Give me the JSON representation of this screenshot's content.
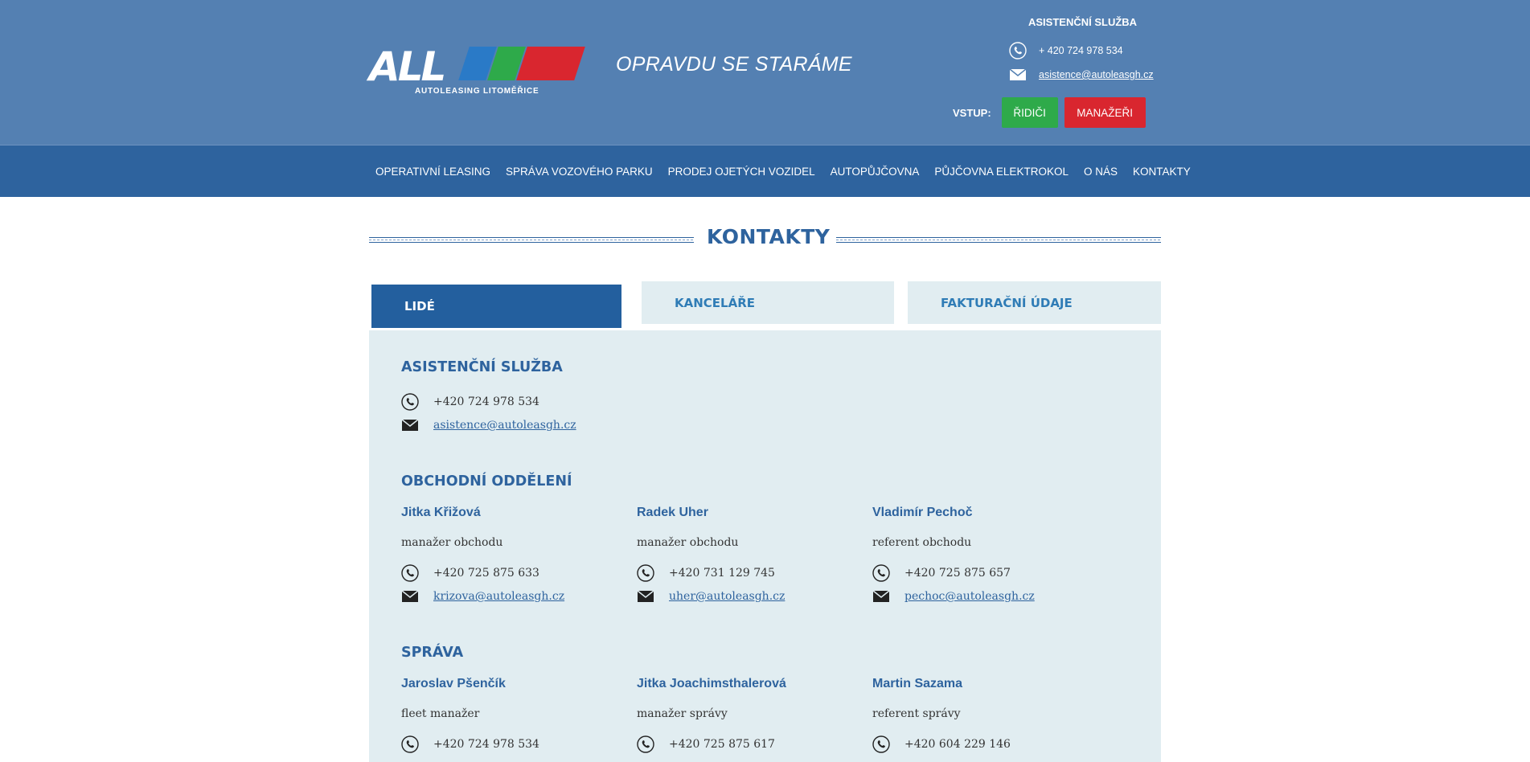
{
  "header": {
    "logo_text": "ALL",
    "logo_subtitle": "AUTOLEASING LITOMĚŘICE",
    "slogan": "OPRAVDU SE STARÁME",
    "assistance": {
      "title": "ASISTENČNÍ SLUŽBA",
      "phone": "+ 420 724 978 534",
      "email": "asistence@autoleasgh.cz",
      "phone_icon": "phone-icon",
      "email_icon": "envelope-icon"
    },
    "login": {
      "label": "VSTUP:",
      "drivers_label": "ŘIDIČI",
      "managers_label": "MANAŽEŘI"
    },
    "colors": {
      "header_bg": "#5480b2",
      "nav_bg": "#2e639e",
      "green": "#2eaa4a",
      "red": "#d9262f",
      "blue": "#2a7ac7"
    }
  },
  "nav": {
    "items": [
      "OPERATIVNÍ LEASING",
      "SPRÁVA VOZOVÉHO PARKU",
      "PRODEJ OJETÝCH VOZIDEL",
      "AUTOPŮJČOVNA",
      "PŮJČOVNA ELEKTROKOL",
      "O NÁS",
      "KONTAKTY"
    ]
  },
  "page": {
    "title": "KONTAKTY"
  },
  "tabs": [
    {
      "label": "LIDÉ",
      "active": true
    },
    {
      "label": "KANCELÁŘE",
      "active": false
    },
    {
      "label": "FAKTURAČNÍ ÚDAJE",
      "active": false
    }
  ],
  "sections": {
    "assistance": {
      "title": "ASISTENČNÍ SLUŽBA",
      "phone": "+420 724 978 534",
      "email": "asistence@autoleasgh.cz"
    },
    "sales": {
      "title": "OBCHODNÍ ODDĚLENÍ",
      "people": [
        {
          "name": "Jitka Křižová",
          "role": "manažer obchodu",
          "phone": "+420 725 875 633",
          "email": "krizova@autoleasgh.cz"
        },
        {
          "name": "Radek Uher",
          "role": "manažer obchodu",
          "phone": "+420 731 129 745",
          "email": "uher@autoleasgh.cz"
        },
        {
          "name": "Vladimír Pechoč",
          "role": "referent obchodu",
          "phone": "+420 725 875 657",
          "email": "pechoc@autoleasgh.cz"
        }
      ]
    },
    "administration": {
      "title": "SPRÁVA",
      "people": [
        {
          "name": "Jaroslav Pšenčík",
          "role": "fleet manažer",
          "phone": "+420 724 978 534"
        },
        {
          "name": "Jitka Joachimsthalerová",
          "role": "manažer správy",
          "phone": "+420 725 875 617"
        },
        {
          "name": "Martin Sazama",
          "role": "referent správy",
          "phone": "+420 604 229 146"
        }
      ]
    }
  }
}
